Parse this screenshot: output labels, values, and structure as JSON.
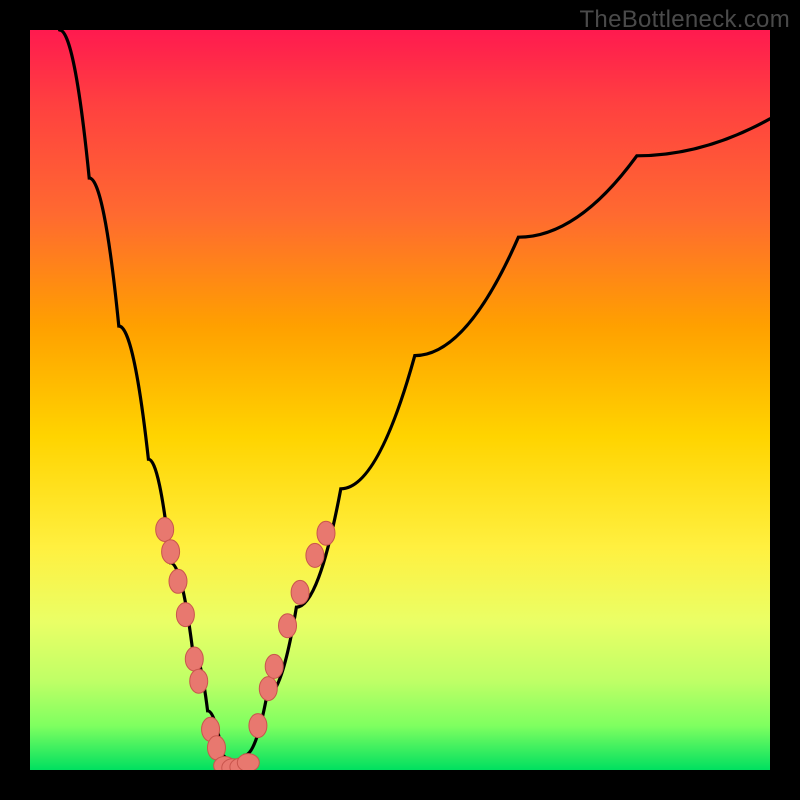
{
  "watermark": "TheBottleneck.com",
  "chart_data": {
    "type": "line",
    "title": "",
    "xlabel": "",
    "ylabel": "",
    "xlim": [
      0,
      100
    ],
    "ylim": [
      0,
      100
    ],
    "grid": false,
    "legend": false,
    "description": "Bottleneck chart: vertical gradient background from red (high bottleneck) to green (low bottleneck). Two black curves descend from upper corners and meet near the bottom forming a V/valley around x≈27. Salmon-colored bead markers lie along both curve arms near the valley.",
    "series": [
      {
        "name": "left-curve",
        "x": [
          4,
          8,
          12,
          16,
          19,
          22,
          24,
          26,
          27
        ],
        "y": [
          100,
          80,
          60,
          42,
          28,
          16,
          8,
          2,
          0
        ]
      },
      {
        "name": "right-curve",
        "x": [
          29,
          32,
          36,
          42,
          52,
          66,
          82,
          100
        ],
        "y": [
          2,
          10,
          22,
          38,
          56,
          72,
          83,
          88
        ]
      }
    ],
    "beads_left": [
      {
        "x": 18.2,
        "y": 32.5
      },
      {
        "x": 19.0,
        "y": 29.5
      },
      {
        "x": 20.0,
        "y": 25.5
      },
      {
        "x": 21.0,
        "y": 21.0
      },
      {
        "x": 22.2,
        "y": 15.0
      },
      {
        "x": 22.8,
        "y": 12.0
      },
      {
        "x": 24.4,
        "y": 5.5
      },
      {
        "x": 25.2,
        "y": 3.0
      }
    ],
    "beads_right": [
      {
        "x": 30.8,
        "y": 6.0
      },
      {
        "x": 32.2,
        "y": 11.0
      },
      {
        "x": 33.0,
        "y": 14.0
      },
      {
        "x": 34.8,
        "y": 19.5
      },
      {
        "x": 36.5,
        "y": 24.0
      },
      {
        "x": 38.5,
        "y": 29.0
      },
      {
        "x": 40.0,
        "y": 32.0
      }
    ],
    "beads_bottom": [
      {
        "x": 26.3,
        "y": 0.6
      },
      {
        "x": 27.4,
        "y": 0.3
      },
      {
        "x": 28.5,
        "y": 0.4
      },
      {
        "x": 29.5,
        "y": 1.0
      }
    ]
  }
}
